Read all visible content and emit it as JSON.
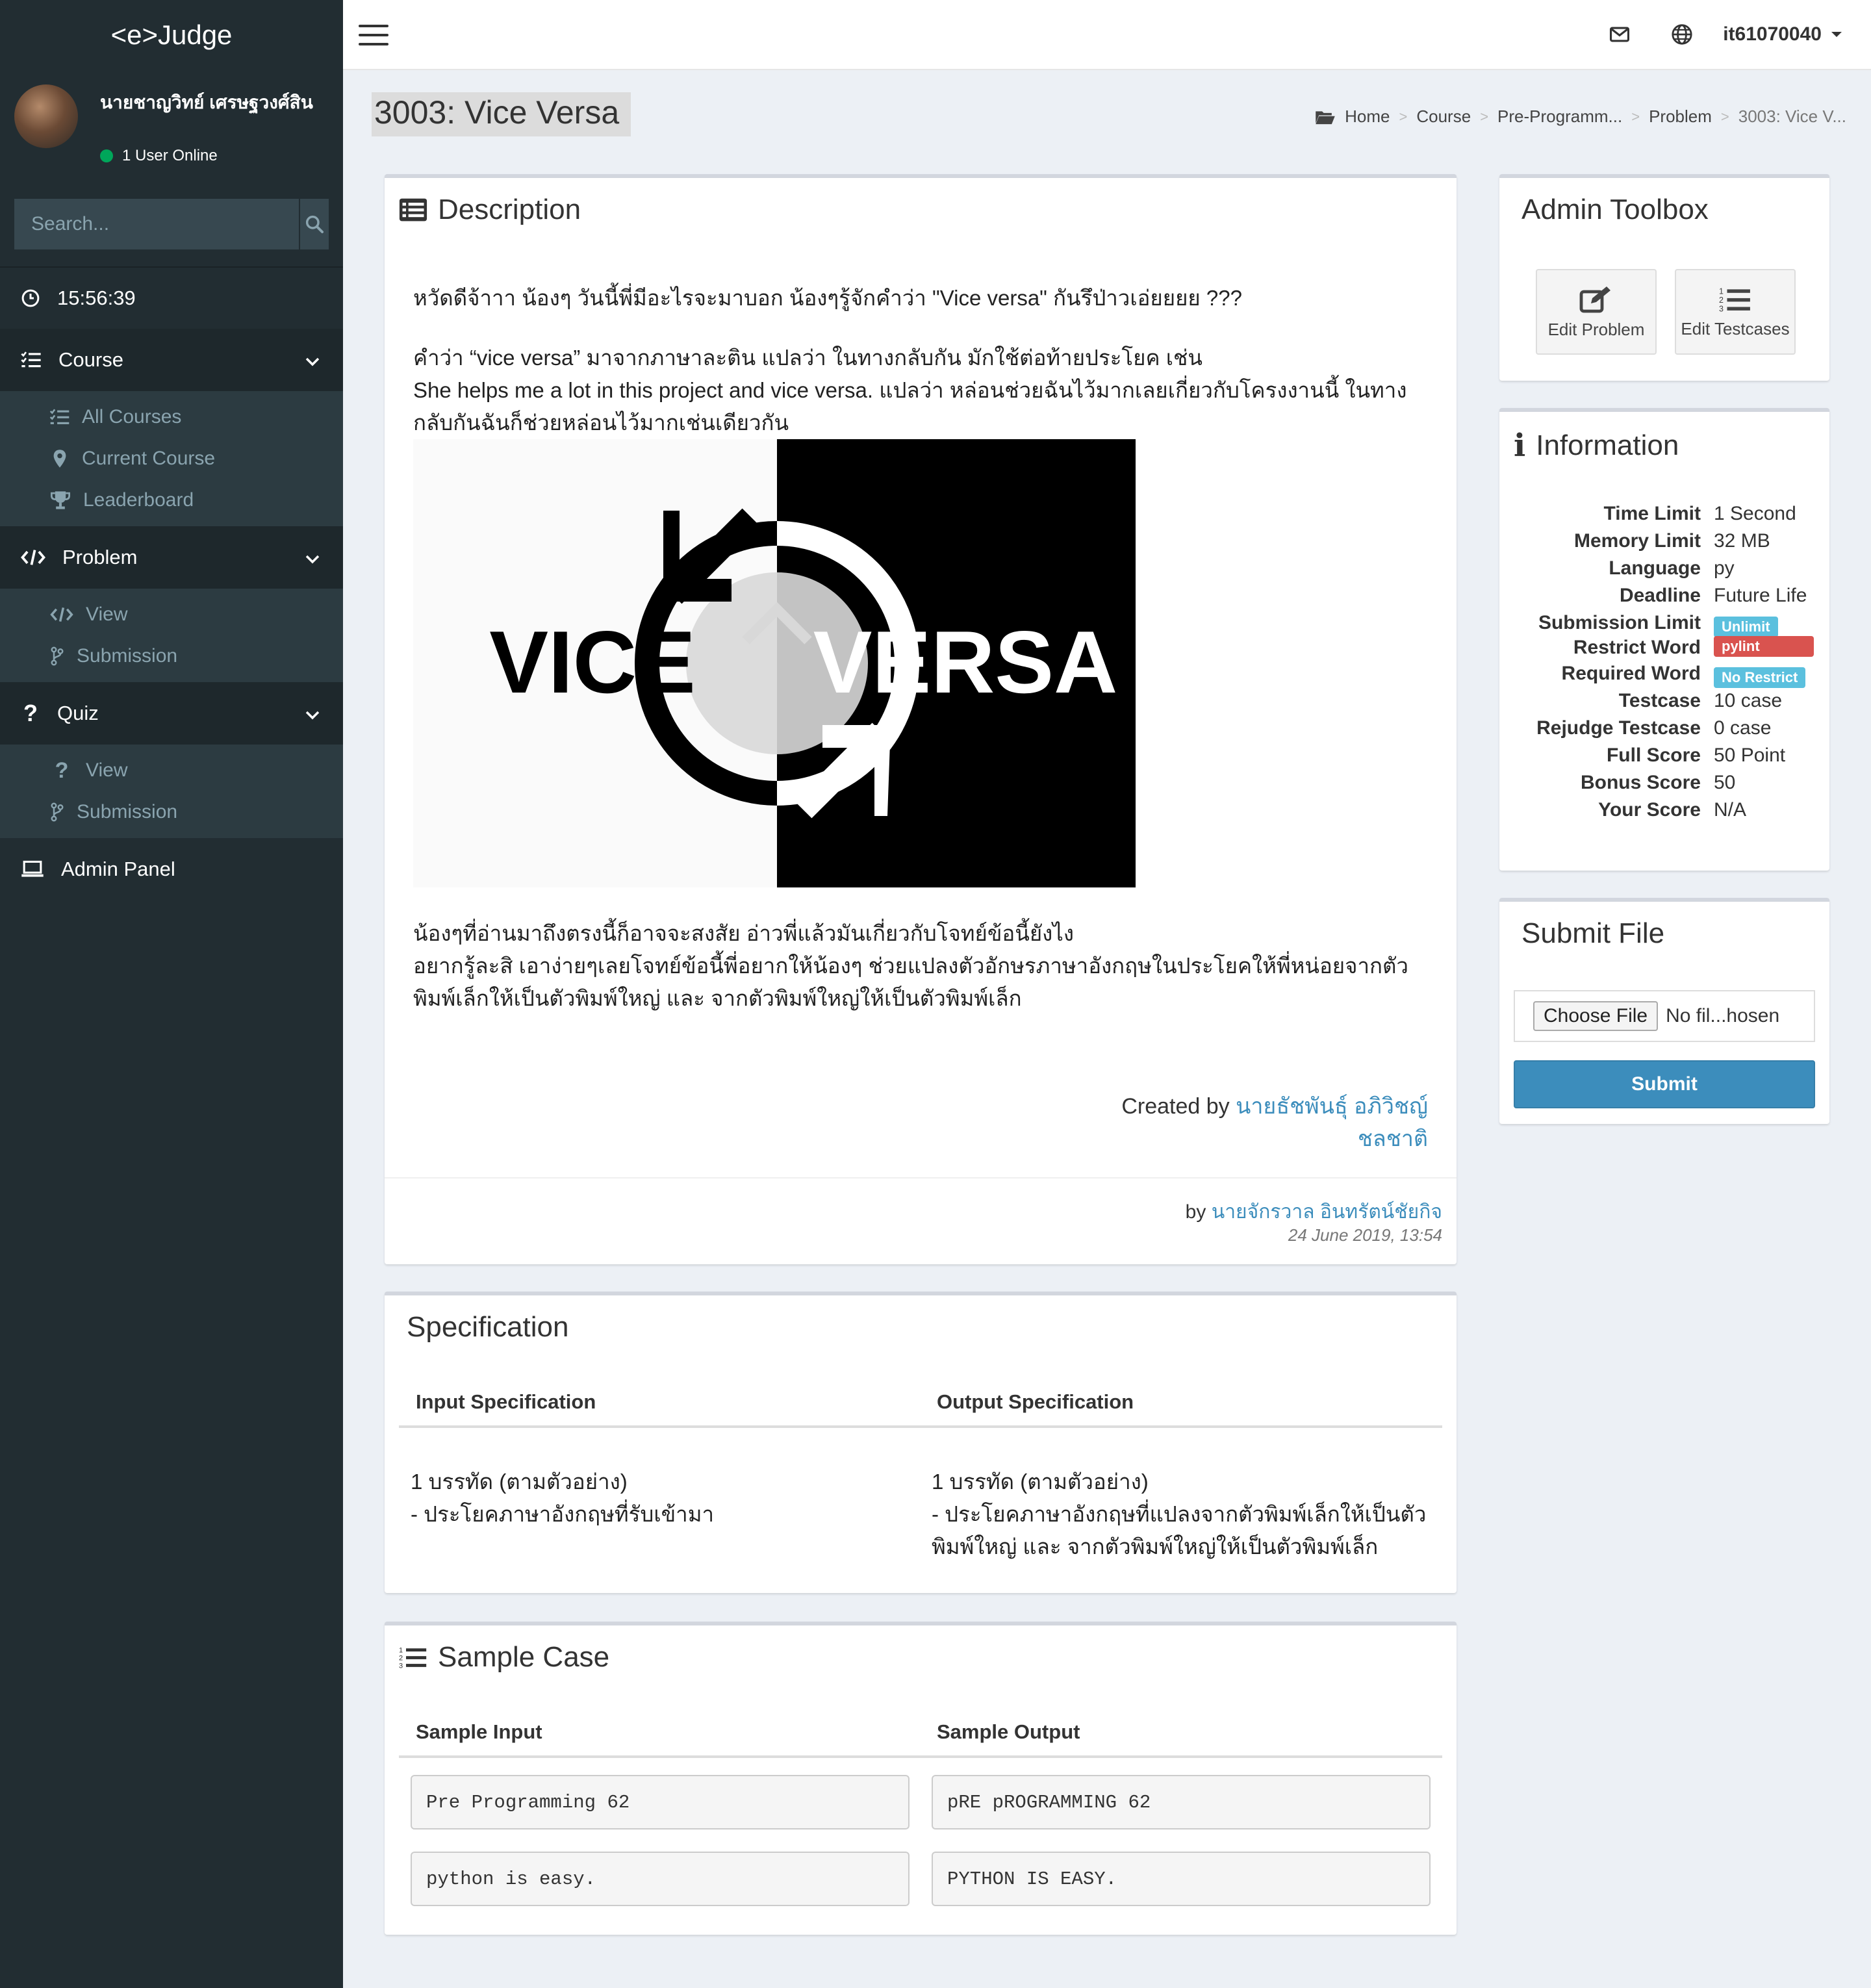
{
  "app": {
    "logo": "<e>Judge"
  },
  "user": {
    "name": "นายชาญวิทย์ เศรษฐวงศ์สิน",
    "status": "1 User Online",
    "username": "it61070040"
  },
  "search": {
    "placeholder": "Search..."
  },
  "clock": "15:56:39",
  "nav": {
    "course": {
      "label": "Course",
      "items": [
        "All Courses",
        "Current Course",
        "Leaderboard"
      ]
    },
    "problem": {
      "label": "Problem",
      "items": [
        "View",
        "Submission"
      ]
    },
    "quiz": {
      "label": "Quiz",
      "items": [
        "View",
        "Submission"
      ]
    },
    "admin": "Admin Panel"
  },
  "page": {
    "title": "3003: Vice Versa"
  },
  "breadcrumb": [
    "Home",
    "Course",
    "Pre-Programm...",
    "Problem",
    "3003: Vice V..."
  ],
  "description": {
    "title": "Description",
    "p1": "หวัดดีจ้าาา น้องๆ วันนี้พี่มีอะไรจะมาบอก น้องๆรู้จักคำว่า \"Vice versa\" กันรึป่าวเอ่ยยยย ???",
    "p2a": "คำว่า “vice versa” มาจากภาษาละติน แปลว่า ในทางกลับกัน  มักใช้ต่อท้ายประโยค เช่น",
    "p2b": "She helps me a lot in this project and vice versa. แปลว่า หล่อนช่วยฉันไว้มากเลยเกี่ยวกับโครงงานนี้ ในทางกลับกันฉันก็ช่วยหล่อนไว้มากเช่นเดียวกัน",
    "image_left": "VICE",
    "image_right": "VERSA",
    "p3a": "น้องๆที่อ่านมาถึงตรงนี้ก็อาจจะสงสัย อ่าวพี่แล้วมันเกี่ยวกับโจทย์ข้อนี้ยังไง",
    "p3b": "อยากรู้ละสิ เอาง่ายๆเลยโจทย์ข้อนี้พี่อยากให้น้องๆ ช่วยแปลงตัวอักษรภาษาอังกฤษในประโยคให้พี่หน่อยจากตัวพิมพ์เล็กให้เป็นตัวพิมพ์ใหญ่ และ จากตัวพิมพ์ใหญ่ให้เป็นตัวพิมพ์เล็ก",
    "created_label": "Created by ",
    "created_by": "นายธัชพันธุ์ อภิวิชญ์ชลชาติ",
    "by_label": "by ",
    "edited_by": "นายจักรวาล อินทรัตน์ชัยกิจ",
    "date": "24 June 2019, 13:54"
  },
  "specification": {
    "title": "Specification",
    "input_header": "Input Specification",
    "output_header": "Output Specification",
    "input_l1": "1 บรรทัด (ตามตัวอย่าง)",
    "input_l2": "- ประโยคภาษาอังกฤษที่รับเข้ามา",
    "output_l1": "1 บรรทัด (ตามตัวอย่าง)",
    "output_l2": "- ประโยคภาษาอังกฤษที่แปลงจากตัวพิมพ์เล็กให้เป็นตัวพิมพ์ใหญ่ และ จากตัวพิมพ์ใหญ่ให้เป็นตัวพิมพ์เล็ก"
  },
  "sample": {
    "title": "Sample Case",
    "input_header": "Sample Input",
    "output_header": "Sample Output",
    "cases": [
      {
        "input": "Pre Programming 62",
        "output": "pRE pROGRAMMING 62"
      },
      {
        "input": "python is easy.",
        "output": "PYTHON IS EASY."
      }
    ]
  },
  "admin_toolbox": {
    "title": "Admin Toolbox",
    "edit_problem": "Edit Problem",
    "edit_testcases": "Edit Testcases"
  },
  "information": {
    "title": "Information",
    "rows": [
      {
        "k": "Time Limit",
        "v": "1 Second"
      },
      {
        "k": "Memory Limit",
        "v": "32 MB"
      },
      {
        "k": "Language",
        "v": "py"
      },
      {
        "k": "Deadline",
        "v": "Future Life"
      },
      {
        "k": "Submission Limit",
        "badge": "Unlimit",
        "color": "#5bc0de"
      },
      {
        "k": "Restrict Word",
        "badge": "pylint",
        "color": "#d9534f"
      },
      {
        "k": "Required Word",
        "badge": "No Restrict",
        "color": "#5bc0de"
      },
      {
        "k": "Testcase",
        "v": "10 case"
      },
      {
        "k": "Rejudge Testcase",
        "v": "0 case"
      },
      {
        "k": "Full Score",
        "v": "50 Point"
      },
      {
        "k": "Bonus Score",
        "v": "50"
      },
      {
        "k": "Your Score",
        "v": "N/A"
      }
    ]
  },
  "submit": {
    "title": "Submit File",
    "choose": "Choose File",
    "file_name": "No fil...hosen",
    "button": "Submit"
  }
}
